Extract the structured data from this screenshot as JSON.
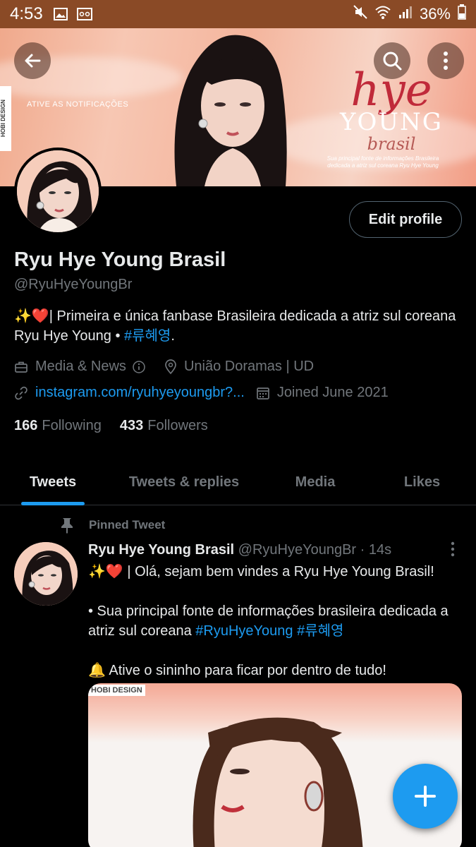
{
  "status_bar": {
    "time": "4:53",
    "battery": "36%"
  },
  "banner": {
    "notification_text": "ATIVE AS NOTIFICAÇÕES",
    "watermark": "HOBI DESIGN",
    "brand_hye": "hye",
    "brand_young": "YOUNG",
    "brand_brasil": "brasil",
    "tagline": "Sua principal fonte de informações Brasileira dedicada a atriz sul coreana Ryu Hye Young"
  },
  "profile": {
    "edit_label": "Edit profile",
    "name": "Ryu Hye Young Brasil",
    "handle": "@RyuHyeYoungBr",
    "bio_prefix": "✨❤️| Primeira e única fanbase Brasileira dedicada a atriz sul coreana Ryu Hye Young • ",
    "bio_hashtag": "#류혜영",
    "bio_suffix": ".",
    "category": "Media & News",
    "location": "União Doramas | UD",
    "link": "instagram.com/ryuhyeyoungbr?...",
    "joined": "Joined June 2021",
    "following_count": "166",
    "following_label": "Following",
    "followers_count": "433",
    "followers_label": "Followers"
  },
  "tabs": [
    {
      "label": "Tweets",
      "active": true
    },
    {
      "label": "Tweets & replies",
      "active": false
    },
    {
      "label": "Media",
      "active": false
    },
    {
      "label": "Likes",
      "active": false
    }
  ],
  "tweet": {
    "pinned_label": "Pinned Tweet",
    "author_name": "Ryu Hye Young Brasil",
    "author_handle": "@RyuHyeYoungBr",
    "time": "· 14s",
    "line1": "✨❤️ | Olá, sejam bem vindes a Ryu Hye Young Brasil!",
    "line2_prefix": "• Sua principal fonte de informações brasileira dedicada a atriz sul coreana ",
    "line2_tag1": "#RyuHyeYoung",
    "line2_tag2": "#류혜영",
    "line3": "🔔 Ative o sininho para ficar por dentro de tudo!",
    "media_watermark": "HOBI DESIGN"
  },
  "colors": {
    "accent": "#1d9bf0",
    "background": "#000000",
    "status_bar": "#8a4a26"
  },
  "icons": [
    "back-arrow-icon",
    "search-icon",
    "more-vertical-icon",
    "briefcase-icon",
    "info-icon",
    "location-pin-icon",
    "link-icon",
    "calendar-icon",
    "pin-icon",
    "plus-icon"
  ]
}
